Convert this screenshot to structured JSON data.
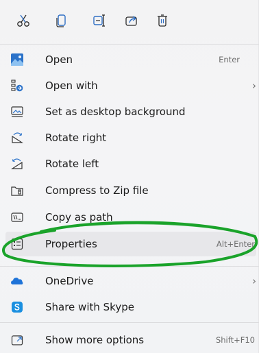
{
  "toolbar": {
    "buttons": [
      {
        "name": "cut",
        "icon": "scissors-icon"
      },
      {
        "name": "copy",
        "icon": "copy-icon"
      },
      {
        "name": "rename",
        "icon": "rename-icon"
      },
      {
        "name": "share",
        "icon": "share-icon"
      },
      {
        "name": "delete",
        "icon": "trash-icon"
      }
    ],
    "accent": "#2f6fc4"
  },
  "menu": {
    "items": [
      {
        "label": "Open",
        "shortcut": "Enter",
        "icon": "image-icon"
      },
      {
        "label": "Open with",
        "shortcut": "",
        "submenu": true,
        "icon": "open-with-icon"
      },
      {
        "label": "Set as desktop background",
        "shortcut": "",
        "icon": "desktop-background-icon"
      },
      {
        "label": "Rotate right",
        "shortcut": "",
        "icon": "rotate-right-icon"
      },
      {
        "label": "Rotate left",
        "shortcut": "",
        "icon": "rotate-left-icon"
      },
      {
        "label": "Compress to Zip file",
        "shortcut": "",
        "icon": "zip-icon"
      },
      {
        "label": "Copy as path",
        "shortcut": "",
        "icon": "copy-path-icon"
      },
      {
        "label": "Properties",
        "shortcut": "Alt+Enter",
        "icon": "properties-icon"
      },
      {
        "label": "OneDrive",
        "shortcut": "",
        "submenu": true,
        "icon": "onedrive-icon"
      },
      {
        "label": "Share with Skype",
        "shortcut": "",
        "icon": "skype-icon"
      },
      {
        "label": "Show more options",
        "shortcut": "Shift+F10",
        "icon": "more-options-icon"
      }
    ],
    "chevron": "›"
  },
  "annotation": {
    "color": "#1aa32a",
    "target": "Properties"
  }
}
